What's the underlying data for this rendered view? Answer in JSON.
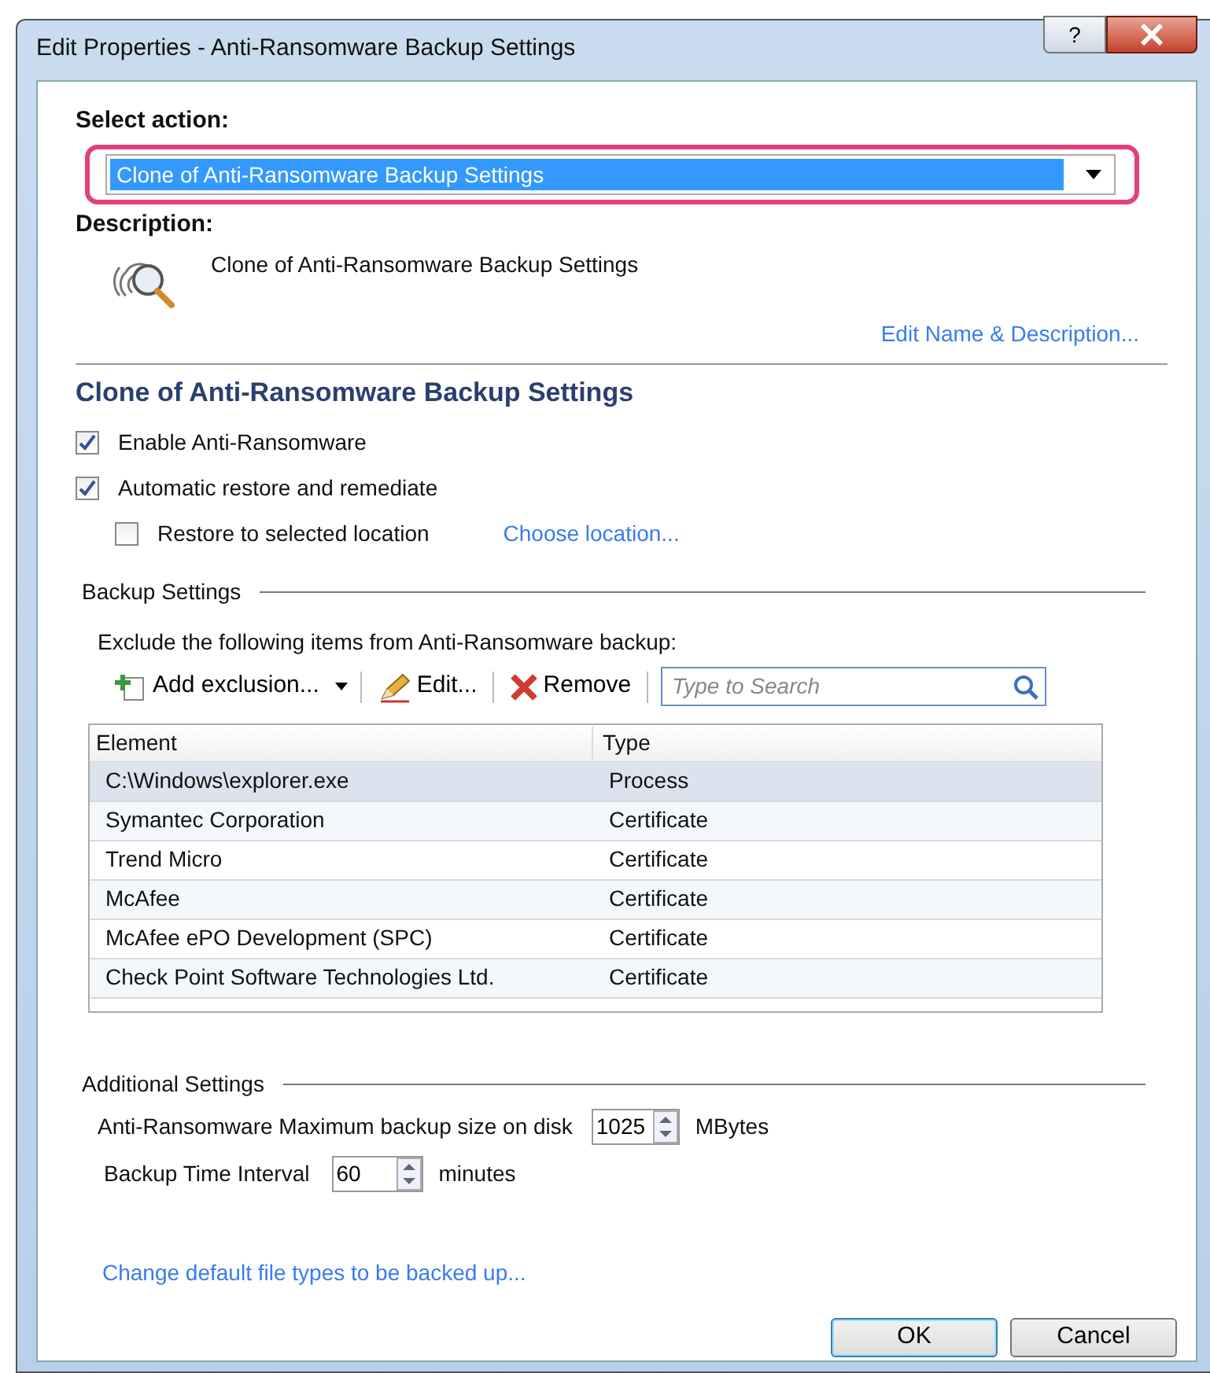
{
  "window": {
    "title": "Edit Properties - Anti-Ransomware Backup Settings",
    "help_label": "?"
  },
  "select_action": {
    "label": "Select action:",
    "value": "Clone of Anti-Ransomware Backup Settings",
    "highlighted": true
  },
  "description": {
    "label": "Description:",
    "text": "Clone of Anti-Ransomware Backup Settings",
    "edit_link": "Edit Name & Description..."
  },
  "heading": "Clone of Anti-Ransomware Backup Settings",
  "options": [
    {
      "label": "Enable Anti-Ransomware",
      "checked": true,
      "indented": false
    },
    {
      "label": "Automatic restore and remediate",
      "checked": true,
      "indented": false
    },
    {
      "label": "Restore to selected location",
      "checked": false,
      "indented": true,
      "link": "Choose location..."
    }
  ],
  "backup_settings": {
    "title": "Backup Settings",
    "instruction": "Exclude the following items from Anti-Ransomware backup:",
    "toolbar": [
      {
        "kind": "add",
        "label": "Add exclusion..."
      },
      {
        "kind": "edit",
        "label": "Edit..."
      },
      {
        "kind": "remove",
        "label": "Remove"
      }
    ],
    "search": {
      "placeholder": "Type to Search"
    },
    "table": {
      "columns": [
        "Element",
        "Type"
      ],
      "rows": [
        {
          "cells": [
            "C:\\Windows\\explorer.exe",
            "Process"
          ],
          "selected": true
        },
        {
          "cells": [
            "Symantec Corporation",
            "Certificate"
          ],
          "selected": false
        },
        {
          "cells": [
            "Trend Micro",
            "Certificate"
          ],
          "selected": false
        },
        {
          "cells": [
            "McAfee",
            "Certificate"
          ],
          "selected": false
        },
        {
          "cells": [
            "McAfee ePO Development (SPC)",
            "Certificate"
          ],
          "selected": false
        },
        {
          "cells": [
            "Check Point Software Technologies Ltd.",
            "Certificate"
          ],
          "selected": false
        }
      ]
    }
  },
  "additional_settings": {
    "title": "Additional Settings",
    "fields": [
      {
        "label": "Anti-Ransomware Maximum backup size on disk",
        "value": "1025",
        "unit": "MBytes"
      },
      {
        "label": "Backup Time Interval",
        "value": "60",
        "unit": "minutes"
      }
    ],
    "link": "Change default file types to be backed up..."
  },
  "buttons": [
    {
      "label": "OK",
      "default": true
    },
    {
      "label": "Cancel",
      "default": false
    }
  ]
}
